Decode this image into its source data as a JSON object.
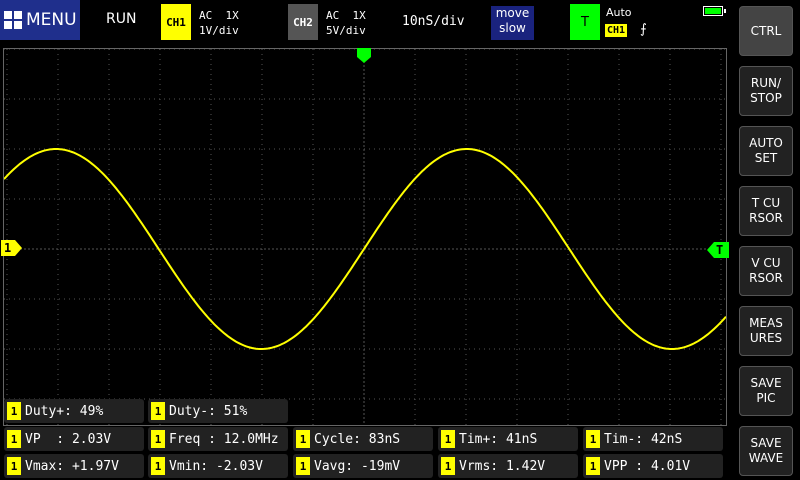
{
  "topbar": {
    "menu_label": "MENU",
    "run_state": "RUN",
    "ch1": {
      "badge": "CH1",
      "coupling": "AC  1X",
      "scale": "1V/div"
    },
    "ch2": {
      "badge": "CH2",
      "coupling": "AC  1X",
      "scale": "5V/div"
    },
    "timebase": "10nS/div",
    "move_line1": "move",
    "move_line2": "slow",
    "trigger": {
      "badge": "T",
      "mode": "Auto",
      "source": "CH1",
      "edge": "⨍"
    },
    "battery_level": 1.0
  },
  "buttons": [
    {
      "label": "CTRL"
    },
    {
      "label": "RUN/\nSTOP"
    },
    {
      "label": "AUTO\nSET"
    },
    {
      "label": "T CU\nRSOR"
    },
    {
      "label": "V CU\nRSOR"
    },
    {
      "label": "MEAS\nURES"
    },
    {
      "label": "SAVE\nPIC"
    },
    {
      "label": "SAVE\nWAVE"
    }
  ],
  "markers": {
    "ch1_level": "1",
    "trigger_level": "T"
  },
  "waveform": {
    "color": "#ffff00",
    "amplitude_div": 2.0,
    "period_div": 8.3,
    "note": ""
  },
  "measurements": {
    "row1": [
      {
        "ch": "1",
        "text": "Duty+: 49%"
      },
      {
        "ch": "1",
        "text": "Duty-: 51%"
      }
    ],
    "row2": [
      {
        "ch": "1",
        "text": "VP  : 2.03V"
      },
      {
        "ch": "1",
        "text": "Freq : 12.0MHz"
      },
      {
        "ch": "1",
        "text": "Cycle: 83nS"
      },
      {
        "ch": "1",
        "text": "Tim+: 41nS"
      },
      {
        "ch": "1",
        "text": "Tim-: 42nS"
      }
    ],
    "row3": [
      {
        "ch": "1",
        "text": "Vmax: +1.97V"
      },
      {
        "ch": "1",
        "text": "Vmin: -2.03V"
      },
      {
        "ch": "1",
        "text": "Vavg: -19mV"
      },
      {
        "ch": "1",
        "text": "Vrms: 1.42V"
      },
      {
        "ch": "1",
        "text": "VPP : 4.01V"
      }
    ]
  },
  "colors": {
    "ch1": "#ffff00",
    "trigger": "#00ff00",
    "menu": "#1f2f8c"
  }
}
